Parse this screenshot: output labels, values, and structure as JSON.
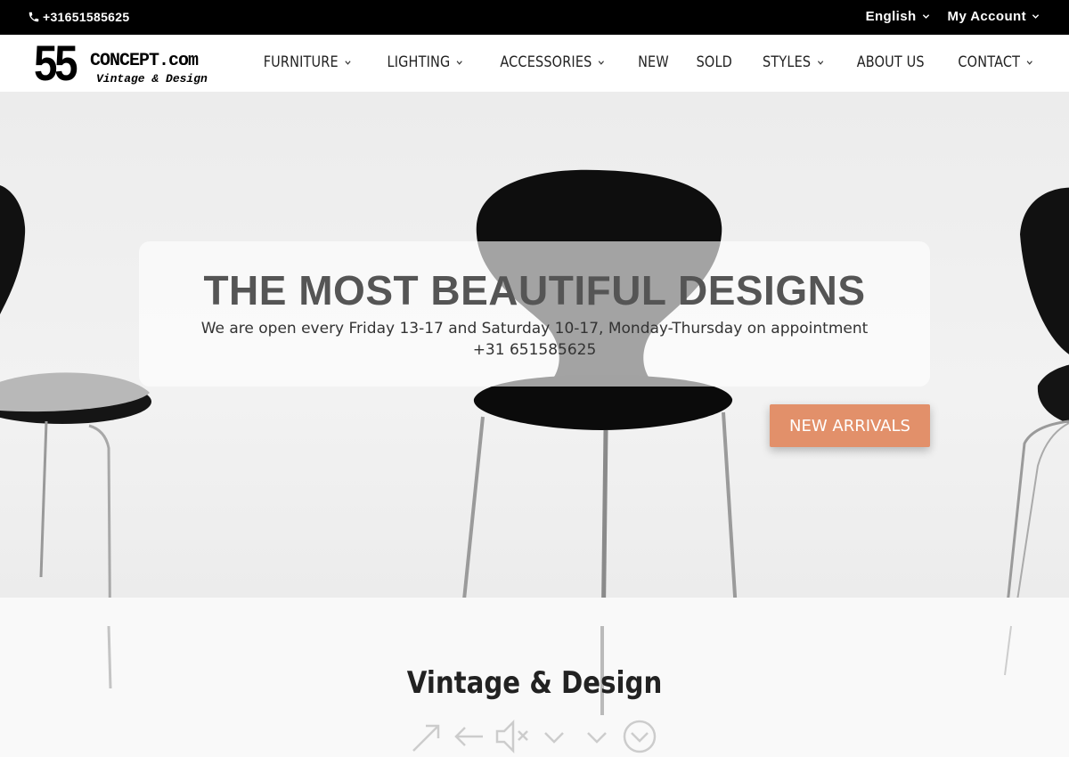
{
  "topbar": {
    "phone": "+31651585625",
    "phone_icon": "phone-icon",
    "links": [
      {
        "label": "English",
        "icon": "chevron-down-icon"
      },
      {
        "label": "My Account",
        "icon": "chevron-down-icon"
      }
    ]
  },
  "logo": {
    "number": "55",
    "site": "CONCEPT.com",
    "tagline": "Vintage & Design"
  },
  "nav": {
    "items": [
      {
        "label": "FURNITURE",
        "dropdown": true
      },
      {
        "label": "LIGHTING",
        "dropdown": true
      },
      {
        "label": "ACCESSORIES",
        "dropdown": true
      },
      {
        "label": "NEW",
        "dropdown": false
      },
      {
        "label": "SOLD",
        "dropdown": false
      },
      {
        "label": "STYLES",
        "dropdown": true
      },
      {
        "label": "ABOUT US",
        "dropdown": false
      },
      {
        "label": "CONTACT",
        "dropdown": true
      }
    ]
  },
  "hero": {
    "title": "THE MOST BEAUTIFUL DESIGNS",
    "subtitle": "We are open every Friday 13-17 and Saturday 10-17, Monday-Thursday on appointment +31 651585625",
    "cta": "NEW ARRIVALS",
    "cta_color": "#e2906a"
  },
  "section": {
    "title": "Vintage & Design"
  },
  "media_controls": {
    "icons": [
      "expand-icon",
      "back-icon",
      "mute-icon",
      "chevron-down-icon",
      "chevron-down-icon",
      "circle-chevron-down-icon"
    ]
  },
  "colors": {
    "topbar_bg": "#000000",
    "header_bg": "#ffffff",
    "accent": "#e2906a"
  }
}
